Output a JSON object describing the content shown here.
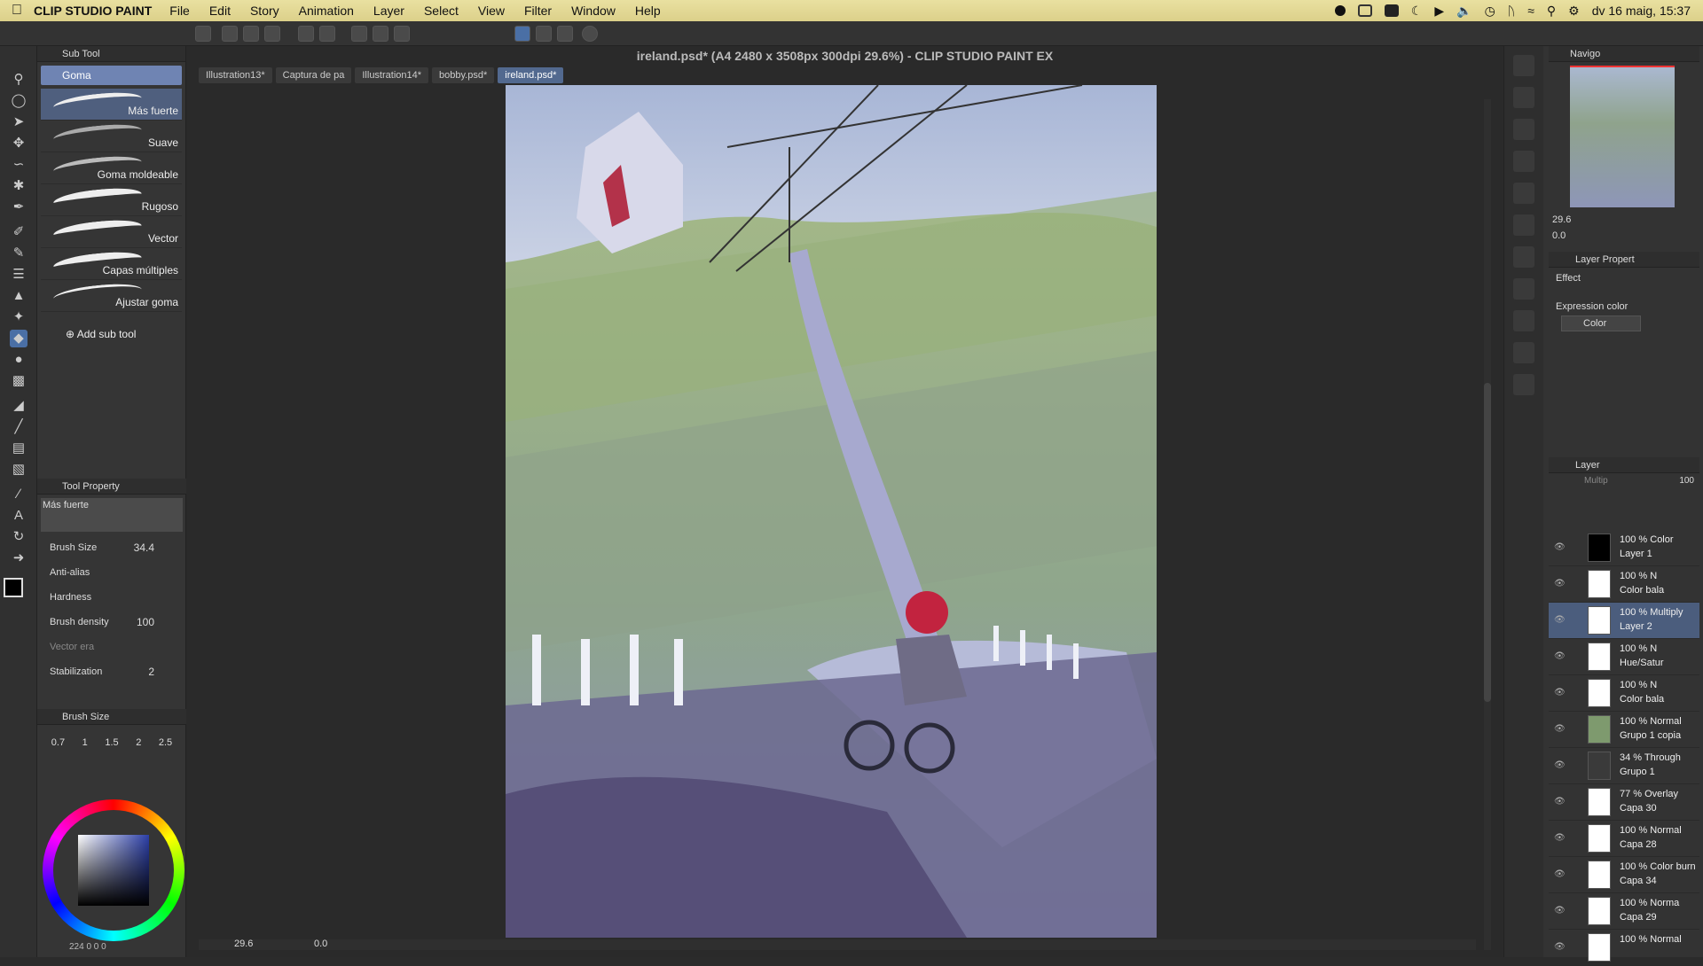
{
  "menubar": {
    "app": "CLIP STUDIO PAINT",
    "items": [
      "File",
      "Edit",
      "Story",
      "Animation",
      "Layer",
      "Select",
      "View",
      "Filter",
      "Window",
      "Help"
    ],
    "datetime": "dv 16 maig, 15:37"
  },
  "document": {
    "title": "ireland.psd* (A4 2480 x 3508px 300dpi 29.6%)  - CLIP STUDIO PAINT EX",
    "tabs": [
      "Illustration13*",
      "Captura de pa",
      "Illustration14*",
      "bobby.psd*",
      "ireland.psd*"
    ],
    "active_tab": "ireland.psd*",
    "zoom": "29.6",
    "rotation": "0.0"
  },
  "subtool": {
    "panel_title": "Sub Tool",
    "group": "Goma",
    "brushes": [
      "Más fuerte",
      "Suave",
      "Goma moldeable",
      "Rugoso",
      "Vector",
      "Capas múltiples",
      "Ajustar goma"
    ],
    "selected": "Más fuerte",
    "add_label": "Add sub tool"
  },
  "tool_property": {
    "panel_title": "Tool Property",
    "preset": "Más fuerte",
    "brush_size_label": "Brush Size",
    "brush_size": "34.4",
    "anti_alias_label": "Anti-alias",
    "hardness_label": "Hardness",
    "density_label": "Brush density",
    "density": "100",
    "vector_label": "Vector era",
    "stabilization_label": "Stabilization",
    "stabilization": "2"
  },
  "brush_size_panel": {
    "title": "Brush Size",
    "sizes": [
      "0.7",
      "1",
      "1.5",
      "2",
      "2.5"
    ]
  },
  "color": {
    "main": "#000000",
    "sub": "#ffffff",
    "footer": "224 0 0 0"
  },
  "navigator": {
    "title": "Navigo",
    "zoom": "29.6",
    "rotate": "0.0"
  },
  "layer_property": {
    "title": "Layer Propert",
    "effect_label": "Effect",
    "expression_label": "Expression color",
    "expression_value": "Color"
  },
  "layer_panel": {
    "title": "Layer",
    "blend": "Multip",
    "opacity": "100",
    "layers": [
      {
        "l1": "100 % Color",
        "l2": "Layer 1",
        "thumb": "#000000"
      },
      {
        "l1": "100 % N",
        "l2": "Color bala",
        "thumb": "#ffffff"
      },
      {
        "l1": "100 % Multiply",
        "l2": "Layer 2",
        "thumb": "#ffffff",
        "selected": true
      },
      {
        "l1": "100 % N",
        "l2": "Hue/Satur",
        "thumb": "#ffffff"
      },
      {
        "l1": "100 % N",
        "l2": "Color bala",
        "thumb": "#ffffff"
      },
      {
        "l1": "100 % Normal",
        "l2": "Grupo 1 copia",
        "thumb": "#7e9a6e"
      },
      {
        "l1": "34 % Through",
        "l2": "Grupo 1",
        "thumb": "#3a3a3a"
      },
      {
        "l1": "77 % Overlay",
        "l2": "Capa 30",
        "thumb": "#ffffff"
      },
      {
        "l1": "100 % Normal",
        "l2": "Capa 28",
        "thumb": "#ffffff"
      },
      {
        "l1": "100 % Color burn",
        "l2": "Capa 34",
        "thumb": "#ffffff"
      },
      {
        "l1": "100 % Norma",
        "l2": "Capa 29",
        "thumb": "#ffffff"
      },
      {
        "l1": "100 % Normal",
        "l2": "",
        "thumb": "#ffffff"
      }
    ]
  }
}
